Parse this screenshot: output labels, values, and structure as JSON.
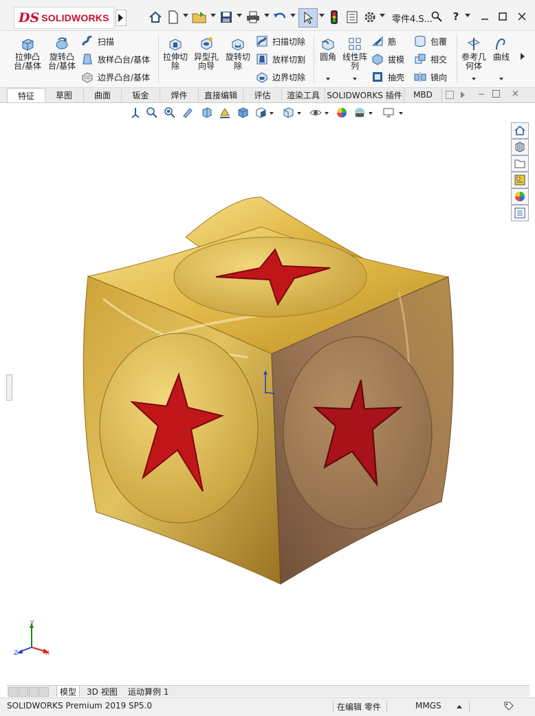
{
  "app": {
    "brand": "SOLIDWORKS",
    "brand_mark": "DS"
  },
  "window": {
    "doc_title": "零件4.S..."
  },
  "quick_access": {
    "icons": [
      "home-icon",
      "new-file-icon",
      "open-file-icon",
      "save-icon",
      "print-icon",
      "undo-icon",
      "select-icon",
      "traffic-light-icon",
      "file-props-icon",
      "gear-icon"
    ],
    "help": "?",
    "window_controls": [
      "minimize",
      "maximize",
      "close"
    ]
  },
  "ribbon": {
    "extrude_boss": "拉伸凸\n台/基体",
    "revolve_boss": "旋转凸\n台/基体",
    "sweep": "扫描",
    "loft_boss": "放样凸台/基体",
    "boundary_boss": "边界凸台/基体",
    "extrude_cut": "拉伸切\n除",
    "hole_wizard": "异型孔\n向导",
    "revolve_cut": "旋转切\n除",
    "sweep_cut": "扫描切除",
    "loft_cut": "放样切割",
    "boundary_cut": "边界切除",
    "fillet": "圆角",
    "linear_pattern": "线性阵\n列",
    "rib": "筋",
    "draft": "拔模",
    "shell": "抽壳",
    "wrap": "包覆",
    "intersect": "相交",
    "mirror": "镜向",
    "ref_geometry": "参考几\n何体",
    "curves": "曲线"
  },
  "tabs": [
    "特征",
    "草图",
    "曲面",
    "钣金",
    "焊件",
    "直接编辑",
    "评估",
    "渲染工具",
    "SOLIDWORKS 插件",
    "MBD"
  ],
  "active_tab": "特征",
  "bottom_tabs": [
    "模型",
    "3D 视图",
    "运动算例 1"
  ],
  "active_bottom_tab": "模型",
  "status": {
    "product": "SOLIDWORKS Premium 2019 SP5.0",
    "mode": "在编辑 零件",
    "units": "MMGS"
  },
  "triad": {
    "y": "Y",
    "x": "X",
    "z": "Z"
  },
  "colors": {
    "gold": "#d4aa3a",
    "star_red": "#c0161a",
    "brand_red": "#c8102e",
    "triad_x": "#d22",
    "triad_y": "#1a8a1a",
    "triad_z": "#1f3fd0"
  }
}
